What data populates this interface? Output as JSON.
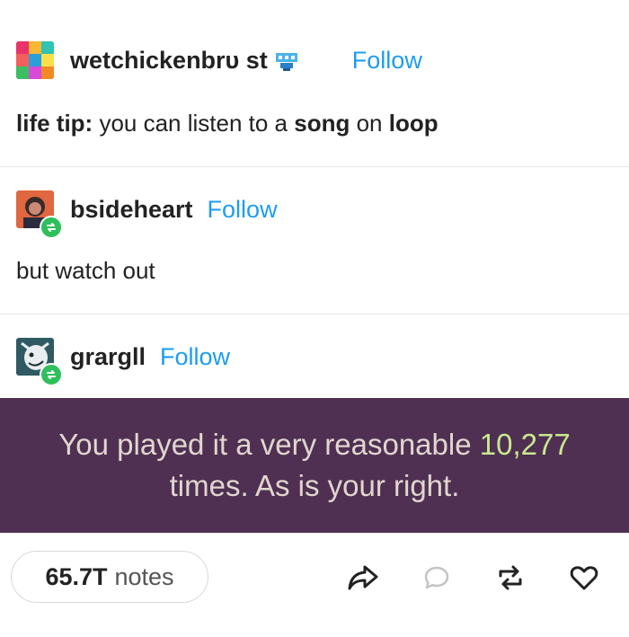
{
  "posts": [
    {
      "username": "wetchickenbrᴜ  st",
      "follow_label": "Follow",
      "text_parts": {
        "bold1": "life tip:",
        "plain1": " you can listen to a ",
        "bold2": "song",
        "plain2": " on ",
        "bold3": "loop"
      }
    },
    {
      "username": "bsideheart",
      "follow_label": "Follow",
      "text": "but watch out"
    },
    {
      "username": "grargll",
      "follow_label": "Follow"
    }
  ],
  "quote": {
    "line1_prefix": "You played it a very reasonable ",
    "line1_number": "10,277",
    "line2": "times. As is your right."
  },
  "footer": {
    "notes_count": "65.7T",
    "notes_label": "notes",
    "icons": [
      "share-icon",
      "reply-icon",
      "reblog-icon",
      "like-icon"
    ]
  },
  "colors": {
    "follow": "#1e9cf0",
    "quote_bg": "#4f3052",
    "quote_text": "#e1d6cf",
    "quote_number": "#c9e88f",
    "reblog_badge": "#2fbf5b"
  }
}
